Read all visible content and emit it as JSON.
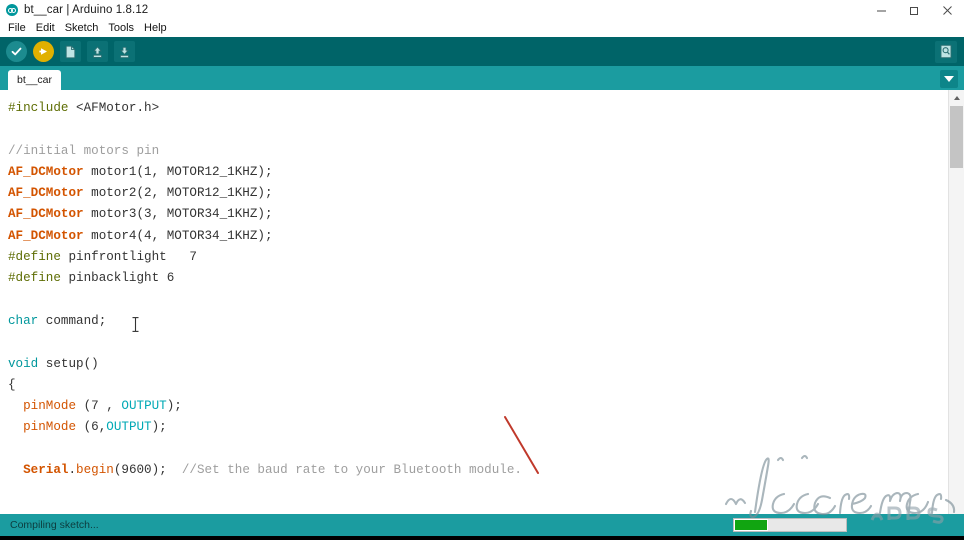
{
  "window": {
    "title": "bt__car | Arduino 1.8.12",
    "app_icon": "arduino-infinity-icon",
    "controls": {
      "minimize": "minimize-icon",
      "maximize": "restore-icon",
      "close": "close-icon"
    }
  },
  "menu": {
    "items": [
      {
        "label": "File"
      },
      {
        "label": "Edit"
      },
      {
        "label": "Sketch"
      },
      {
        "label": "Tools"
      },
      {
        "label": "Help"
      }
    ]
  },
  "toolbar": {
    "verify_label": "Verify",
    "upload_label": "Upload",
    "new_label": "New",
    "open_label": "Open",
    "save_label": "Save",
    "serial_monitor_label": "Serial Monitor",
    "icons": [
      "check-icon",
      "upload-arrow-icon",
      "new-file-icon",
      "open-up-arrow-icon",
      "save-down-arrow-icon",
      "serial-monitor-magnifier-icon"
    ]
  },
  "tabs": {
    "active": "bt__car",
    "items": [
      {
        "label": "bt__car"
      }
    ],
    "dropdown_icon": "chevron-down-icon"
  },
  "editor": {
    "lines": [
      [
        {
          "t": "#include ",
          "c": "k-pre"
        },
        {
          "t": "<AFMotor.h>",
          "c": "k-plain"
        }
      ],
      [],
      [
        {
          "t": "//initial motors pin",
          "c": "k-cmt"
        }
      ],
      [
        {
          "t": "AF_DCMotor",
          "c": "k-lib"
        },
        {
          "t": " motor1(1, MOTOR12_1KHZ);",
          "c": "k-plain"
        }
      ],
      [
        {
          "t": "AF_DCMotor",
          "c": "k-lib"
        },
        {
          "t": " motor2(2, MOTOR12_1KHZ);",
          "c": "k-plain"
        }
      ],
      [
        {
          "t": "AF_DCMotor",
          "c": "k-lib"
        },
        {
          "t": " motor3(3, MOTOR34_1KHZ);",
          "c": "k-plain"
        }
      ],
      [
        {
          "t": "AF_DCMotor",
          "c": "k-lib"
        },
        {
          "t": " motor4(4, MOTOR34_1KHZ);",
          "c": "k-plain"
        }
      ],
      [
        {
          "t": "#define",
          "c": "k-pre"
        },
        {
          "t": " pinfrontlight   7",
          "c": "k-plain"
        }
      ],
      [
        {
          "t": "#define",
          "c": "k-pre"
        },
        {
          "t": " pinbacklight 6",
          "c": "k-plain"
        }
      ],
      [],
      [
        {
          "t": "char",
          "c": "k-type"
        },
        {
          "t": " command;",
          "c": "k-plain"
        }
      ],
      [],
      [
        {
          "t": "void",
          "c": "k-type"
        },
        {
          "t": " setup()",
          "c": "k-plain"
        }
      ],
      [
        {
          "t": "{",
          "c": "k-plain"
        }
      ],
      [
        {
          "t": "  pinMode",
          "c": "k-fn"
        },
        {
          "t": " (7 , ",
          "c": "k-plain"
        },
        {
          "t": "OUTPUT",
          "c": "k-const"
        },
        {
          "t": ");",
          "c": "k-plain"
        }
      ],
      [
        {
          "t": "  pinMode",
          "c": "k-fn"
        },
        {
          "t": " (6,",
          "c": "k-plain"
        },
        {
          "t": "OUTPUT",
          "c": "k-const"
        },
        {
          "t": ");",
          "c": "k-plain"
        }
      ],
      [],
      [
        {
          "t": "  Serial",
          "c": "k-lib"
        },
        {
          "t": ".",
          "c": "k-plain"
        },
        {
          "t": "begin",
          "c": "k-fn"
        },
        {
          "t": "(9600);  ",
          "c": "k-plain"
        },
        {
          "t": "//Set the baud rate to your Bluetooth module.",
          "c": "k-cmt"
        }
      ]
    ],
    "mouse_cursor": "text-ibeam-cursor",
    "annotation": "red-diagonal-line"
  },
  "scrollbar": {
    "up_arrow_icon": "scroll-up-arrow-icon",
    "thumb": "vertical-scroll-thumb"
  },
  "status": {
    "message": "Compiling sketch...",
    "progress_percent": 30
  },
  "watermark": {
    "line1": "Icecream",
    "line2": "APPS"
  },
  "colors": {
    "toolbar_bg": "#006468",
    "tabbar_bg": "#1b9ca0",
    "statusbar_bg": "#1b9ca0",
    "accent_teal": "#00979c",
    "upload_yellow": "#e0b000",
    "progress_green": "#11a511",
    "annotation_red": "#c0392b"
  }
}
